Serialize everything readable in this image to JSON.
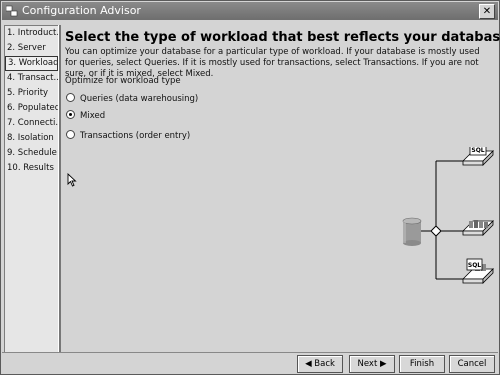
{
  "window": {
    "title": "Configuration Advisor",
    "close_symbol": "✕"
  },
  "sidebar": {
    "items": [
      {
        "label": "1. Introduct..."
      },
      {
        "label": "2. Server"
      },
      {
        "label": "3. Workload",
        "selected": true
      },
      {
        "label": "4. Transact..."
      },
      {
        "label": "5. Priority"
      },
      {
        "label": "6. Populated"
      },
      {
        "label": "7. Connecti..."
      },
      {
        "label": "8. Isolation"
      },
      {
        "label": "9. Schedule"
      },
      {
        "label": "10. Results"
      }
    ]
  },
  "main": {
    "heading": "Select the type of workload that best reflects your database.",
    "description": "You can optimize your database for a particular type of workload. If your database is mostly used for queries, select Queries. If it is mostly used for transactions, select Transactions. If you are not sure, or if it is mixed, select Mixed.",
    "optimize_label": "Optimize for workload type",
    "options": [
      {
        "label": "Queries (data warehousing)",
        "checked": false
      },
      {
        "label": "Mixed",
        "checked": true
      },
      {
        "label": "Transactions (order entry)",
        "checked": false
      }
    ]
  },
  "diagram": {
    "sql_label": "SQL"
  },
  "buttons": {
    "back": "◀ Back",
    "next": "Next ▶",
    "finish": "Finish",
    "cancel": "Cancel"
  }
}
